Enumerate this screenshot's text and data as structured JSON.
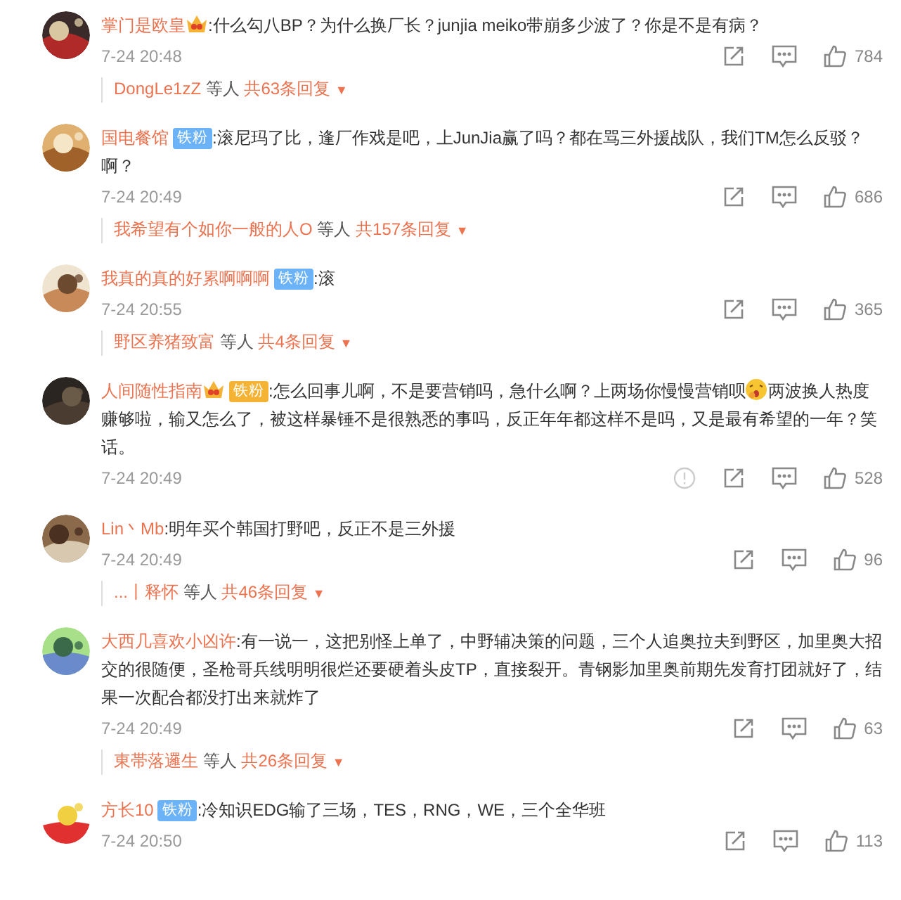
{
  "comments": [
    {
      "author": "掌门是欧皇",
      "badges": [
        {
          "kind": "crown"
        }
      ],
      "segments": [
        {
          "kind": "text",
          "text": ":什么勾八BP？为什么换厂长？junjia meiko带崩多少波了？你是不是有病？"
        }
      ],
      "time": "7-24 20:48",
      "likes": "784",
      "report": false,
      "reply": {
        "names": "DongLe1zZ",
        "suffix": "等人",
        "count": "共63条回复",
        "caret": "▼"
      }
    },
    {
      "author": "国电餐馆",
      "badges": [
        {
          "kind": "fan",
          "label": "铁粉",
          "color": "#6bb3f6"
        }
      ],
      "segments": [
        {
          "kind": "text",
          "text": ":滚尼玛了比，逢厂作戏是吧，上JunJia赢了吗？都在骂三外援战队，我们TM怎么反驳？啊？"
        }
      ],
      "time": "7-24 20:49",
      "likes": "686",
      "report": false,
      "reply": {
        "names": "我希望有个如你一般的人O",
        "suffix": "等人",
        "count": "共157条回复",
        "caret": "▼"
      }
    },
    {
      "author": "我真的真的好累啊啊啊",
      "badges": [
        {
          "kind": "fan",
          "label": "铁粉",
          "color": "#6bb3f6"
        }
      ],
      "segments": [
        {
          "kind": "text",
          "text": ":滚"
        }
      ],
      "time": "7-24 20:55",
      "likes": "365",
      "report": false,
      "reply": {
        "names": "野区养猪致富",
        "suffix": "等人",
        "count": "共4条回复",
        "caret": "▼"
      }
    },
    {
      "author": "人间随性指南",
      "badges": [
        {
          "kind": "crown"
        },
        {
          "kind": "fan",
          "label": "铁粉",
          "color": "#f5b335"
        }
      ],
      "segments": [
        {
          "kind": "text",
          "text": ":怎么回事儿啊，不是要营销吗，急什么啊？上两场你慢慢营销呗"
        },
        {
          "kind": "emoji"
        },
        {
          "kind": "text",
          "text": "两波换人热度赚够啦，输又怎么了，被这样暴锤不是很熟悉的事吗，反正年年都这样不是吗，又是最有希望的一年？笑话。"
        }
      ],
      "time": "7-24 20:49",
      "likes": "528",
      "report": true
    },
    {
      "author": "Lin丶Mb",
      "segments": [
        {
          "kind": "text",
          "text": ":明年买个韩国打野吧，反正不是三外援"
        }
      ],
      "time": "7-24 20:49",
      "likes": "96",
      "report": false,
      "reply": {
        "names": "...丨释怀",
        "suffix": "等人",
        "count": "共46条回复",
        "caret": "▼"
      }
    },
    {
      "author": "大西几喜欢小凶许",
      "segments": [
        {
          "kind": "text",
          "text": ":有一说一，这把别怪上单了，中野辅决策的问题，三个人追奥拉夫到野区，加里奥大招交的很随便，圣枪哥兵线明明很烂还要硬着头皮TP，直接裂开。青钢影加里奥前期先发育打团就好了，结果一次配合都没打出来就炸了"
        }
      ],
      "time": "7-24 20:49",
      "likes": "63",
      "report": false,
      "reply": {
        "names": "東帯落邏生",
        "suffix": "等人",
        "count": "共26条回复",
        "caret": "▼"
      }
    },
    {
      "author": "方长10",
      "badges": [
        {
          "kind": "fan",
          "label": "铁粉",
          "color": "#6bb3f6"
        }
      ],
      "segments": [
        {
          "kind": "text",
          "text": ":冷知识EDG输了三场，TES，RNG，WE，三个全华班"
        }
      ],
      "time": "7-24 20:50",
      "likes": "113",
      "report": false
    }
  ]
}
